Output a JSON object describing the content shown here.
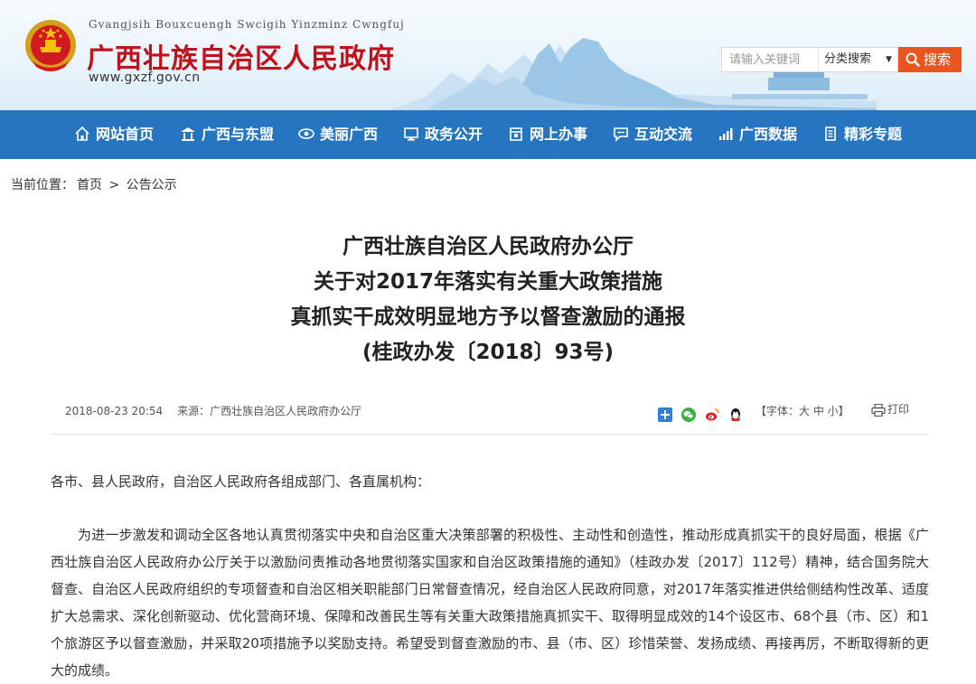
{
  "header": {
    "pinyin": "Gvangjsih Bouxcuengh Swcigih Yinzminz Cwngfuj",
    "site_title": "广西壮族自治区人民政府",
    "site_url": "www.gxzf.gov.cn",
    "emblem_icon": "national-emblem-icon"
  },
  "search": {
    "placeholder": "请输入关键词",
    "select_value": "分类搜索",
    "button_label": "搜索",
    "button_color": "#e9541f"
  },
  "nav": {
    "bg_color": "#2575c0",
    "items": [
      {
        "label": "网站首页",
        "icon": "home-icon"
      },
      {
        "label": "广西与东盟",
        "icon": "pavilion-icon"
      },
      {
        "label": "美丽广西",
        "icon": "eye-icon"
      },
      {
        "label": "政务公开",
        "icon": "monitor-icon"
      },
      {
        "label": "网上办事",
        "icon": "calendar-icon"
      },
      {
        "label": "互动交流",
        "icon": "chat-icon"
      },
      {
        "label": "广西数据",
        "icon": "bar-signal-icon"
      },
      {
        "label": "精彩专题",
        "icon": "document-icon"
      }
    ]
  },
  "breadcrumb": {
    "prefix": "当前位置：",
    "home": "首页",
    "separator": ">",
    "current": "公告公示"
  },
  "article": {
    "title_lines": [
      "广西壮族自治区人民政府办公厅",
      "关于对2017年落实有关重大政策措施",
      "真抓实干成效明显地方予以督查激励的通报",
      "(桂政办发〔2018〕93号)"
    ],
    "date": "2018-08-23 20:54",
    "source": "来源：广西壮族自治区人民政府办公厅",
    "font_size_label": "【字体：大 中 小】",
    "print_label": "打印",
    "salutation": "各市、县人民政府，自治区人民政府各组成部门、各直属机构：",
    "paragraph": "为进一步激发和调动全区各地认真贯彻落实中央和自治区重大决策部署的积极性、主动性和创造性，推动形成真抓实干的良好局面，根据《广西壮族自治区人民政府办公厅关于以激励问责推动各地贯彻落实国家和自治区政策措施的通知》（桂政办发〔2017〕112号）精神，结合国务院大督查、自治区人民政府组织的专项督查和自治区相关职能部门日常督查情况，经自治区人民政府同意，对2017年落实推进供给侧结构性改革、适度扩大总需求、深化创新驱动、优化营商环境、保障和改善民生等有关重大政策措施真抓实干、取得明显成效的14个设区市、68个县（市、区）和1个旅游区予以督查激励，并采取20项措施予以奖励支持。希望受到督查激励的市、县（市、区）珍惜荣誉、发扬成绩、再接再厉，不断取得新的更大的成绩。"
  },
  "share_icons": [
    "share-plus-icon",
    "wechat-icon",
    "weibo-icon",
    "qq-icon"
  ]
}
